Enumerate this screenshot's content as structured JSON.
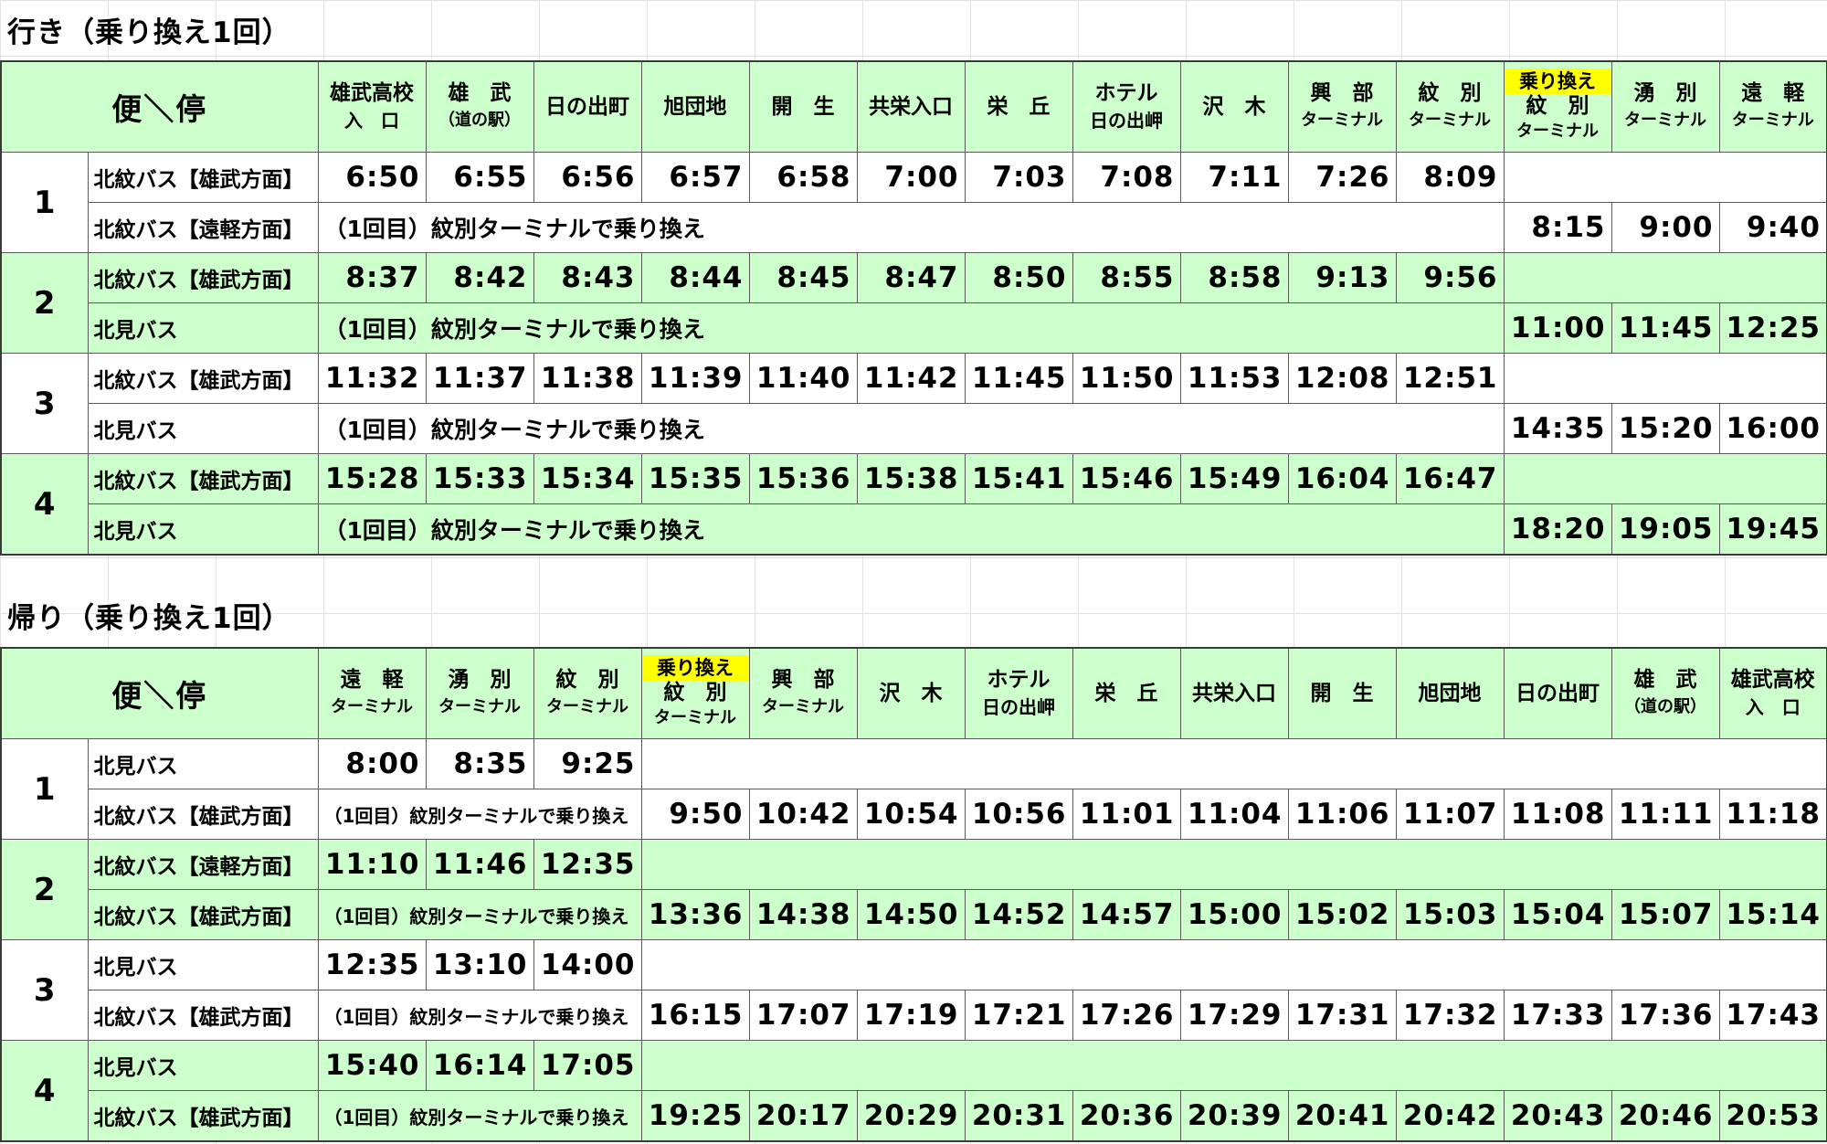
{
  "outbound": {
    "title": "行き（乗り換え1回）",
    "corner_label": "便＼停",
    "stops": [
      {
        "l1": "雄武高校",
        "l2": "入　口",
        "l2_small": false
      },
      {
        "l1": "雄　武",
        "l2": "（道の駅）",
        "l2_small": true
      },
      {
        "l1": "日の出町",
        "l2": ""
      },
      {
        "l1": "旭団地",
        "l2": ""
      },
      {
        "l1": "開　生",
        "l2": ""
      },
      {
        "l1": "共栄入口",
        "l2": ""
      },
      {
        "l1": "栄　丘",
        "l2": ""
      },
      {
        "l1": "ホテル",
        "l2": "日の出岬",
        "l2_small": false
      },
      {
        "l1": "沢　木",
        "l2": ""
      },
      {
        "l1": "興　部",
        "l2": "ターミナル",
        "l2_small": true
      },
      {
        "l1": "紋　別",
        "l2": "ターミナル",
        "l2_small": true
      },
      {
        "tag": "乗り換え",
        "l1": "紋　別",
        "l2": "ターミナル",
        "l2_small": true
      },
      {
        "l1": "湧　別",
        "l2": "ターミナル",
        "l2_small": true
      },
      {
        "l1": "遠　軽",
        "l2": "ターミナル",
        "l2_small": true
      }
    ],
    "trips": [
      {
        "no": "1",
        "bus1": "北紋バス【雄武方面】",
        "times1": [
          "6:50",
          "6:55",
          "6:56",
          "6:57",
          "6:58",
          "7:00",
          "7:03",
          "7:08",
          "7:11",
          "7:26",
          "8:09"
        ],
        "bus2": "北紋バス【遠軽方面】",
        "note": "（1回目）紋別ターミナルで乗り換え",
        "times2": [
          "8:15",
          "9:00",
          "9:40"
        ]
      },
      {
        "no": "2",
        "bus1": "北紋バス【雄武方面】",
        "times1": [
          "8:37",
          "8:42",
          "8:43",
          "8:44",
          "8:45",
          "8:47",
          "8:50",
          "8:55",
          "8:58",
          "9:13",
          "9:56"
        ],
        "bus2": "北見バス",
        "note": "（1回目）紋別ターミナルで乗り換え",
        "times2": [
          "11:00",
          "11:45",
          "12:25"
        ]
      },
      {
        "no": "3",
        "bus1": "北紋バス【雄武方面】",
        "times1": [
          "11:32",
          "11:37",
          "11:38",
          "11:39",
          "11:40",
          "11:42",
          "11:45",
          "11:50",
          "11:53",
          "12:08",
          "12:51"
        ],
        "bus2": "北見バス",
        "note": "（1回目）紋別ターミナルで乗り換え",
        "times2": [
          "14:35",
          "15:20",
          "16:00"
        ]
      },
      {
        "no": "4",
        "bus1": "北紋バス【雄武方面】",
        "times1": [
          "15:28",
          "15:33",
          "15:34",
          "15:35",
          "15:36",
          "15:38",
          "15:41",
          "15:46",
          "15:49",
          "16:04",
          "16:47"
        ],
        "bus2": "北見バス",
        "note": "（1回目）紋別ターミナルで乗り換え",
        "times2": [
          "18:20",
          "19:05",
          "19:45"
        ]
      }
    ]
  },
  "inbound": {
    "title": "帰り（乗り換え1回）",
    "corner_label": "便＼停",
    "stops": [
      {
        "l1": "遠　軽",
        "l2": "ターミナル",
        "l2_small": true
      },
      {
        "l1": "湧　別",
        "l2": "ターミナル",
        "l2_small": true
      },
      {
        "l1": "紋　別",
        "l2": "ターミナル",
        "l2_small": true
      },
      {
        "tag": "乗り換え",
        "l1": "紋　別",
        "l2": "ターミナル",
        "l2_small": true
      },
      {
        "l1": "興　部",
        "l2": "ターミナル",
        "l2_small": true
      },
      {
        "l1": "沢　木",
        "l2": ""
      },
      {
        "l1": "ホテル",
        "l2": "日の出岬",
        "l2_small": false
      },
      {
        "l1": "栄　丘",
        "l2": ""
      },
      {
        "l1": "共栄入口",
        "l2": ""
      },
      {
        "l1": "開　生",
        "l2": ""
      },
      {
        "l1": "旭団地",
        "l2": ""
      },
      {
        "l1": "日の出町",
        "l2": ""
      },
      {
        "l1": "雄　武",
        "l2": "（道の駅）",
        "l2_small": true
      },
      {
        "l1": "雄武高校",
        "l2": "入　口",
        "l2_small": false
      }
    ],
    "trips": [
      {
        "no": "1",
        "bus1": "北見バス",
        "times1": [
          "8:00",
          "8:35",
          "9:25"
        ],
        "bus2": "北紋バス【雄武方面】",
        "note": "（1回目）紋別ターミナルで乗り換え",
        "times2": [
          "9:50",
          "10:42",
          "10:54",
          "10:56",
          "11:01",
          "11:04",
          "11:06",
          "11:07",
          "11:08",
          "11:11",
          "11:18"
        ]
      },
      {
        "no": "2",
        "bus1": "北紋バス【遠軽方面】",
        "times1": [
          "11:10",
          "11:46",
          "12:35"
        ],
        "bus2": "北紋バス【雄武方面】",
        "note": "（1回目）紋別ターミナルで乗り換え",
        "times2": [
          "13:36",
          "14:38",
          "14:50",
          "14:52",
          "14:57",
          "15:00",
          "15:02",
          "15:03",
          "15:04",
          "15:07",
          "15:14"
        ]
      },
      {
        "no": "3",
        "bus1": "北見バス",
        "times1": [
          "12:35",
          "13:10",
          "14:00"
        ],
        "bus2": "北紋バス【雄武方面】",
        "note": "（1回目）紋別ターミナルで乗り換え",
        "times2": [
          "16:15",
          "17:07",
          "17:19",
          "17:21",
          "17:26",
          "17:29",
          "17:31",
          "17:32",
          "17:33",
          "17:36",
          "17:43"
        ]
      },
      {
        "no": "4",
        "bus1": "北見バス",
        "times1": [
          "15:40",
          "16:14",
          "17:05"
        ],
        "bus2": "北紋バス【雄武方面】",
        "note": "（1回目）紋別ターミナルで乗り換え",
        "times2": [
          "19:25",
          "20:17",
          "20:29",
          "20:31",
          "20:36",
          "20:39",
          "20:41",
          "20:42",
          "20:43",
          "20:46",
          "20:53"
        ]
      }
    ]
  }
}
